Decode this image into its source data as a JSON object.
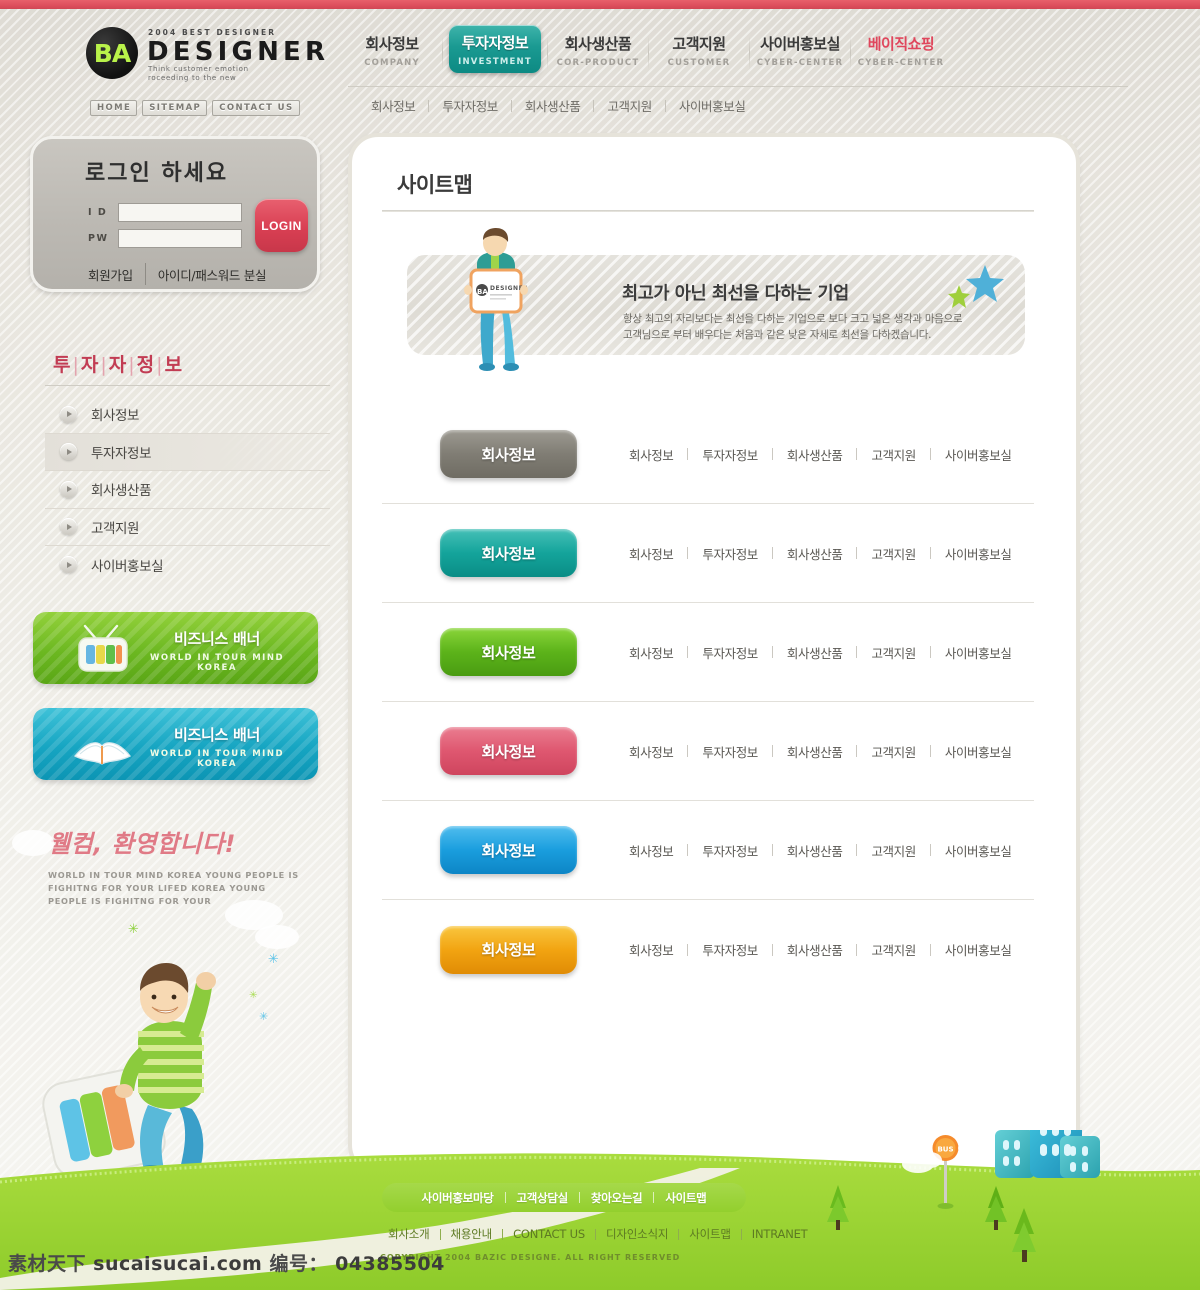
{
  "brand": {
    "badge": "BA",
    "sup": "2004 BEST DESIGNER",
    "name": "DESIGNER",
    "tagline_l1": "Think customer emotion",
    "tagline_l2": "roceeding to the new"
  },
  "mininav": [
    {
      "label": "HOME"
    },
    {
      "label": "SITEMAP"
    },
    {
      "label": "CONTACT US"
    }
  ],
  "mainnav": [
    {
      "kr": "회사정보",
      "en": "COMPANY",
      "active": false,
      "accent": false
    },
    {
      "kr": "투자자정보",
      "en": "INVESTMENT",
      "active": true,
      "accent": false
    },
    {
      "kr": "회사생산품",
      "en": "COR-PRODUCT",
      "active": false,
      "accent": false
    },
    {
      "kr": "고객지원",
      "en": "CUSTOMER",
      "active": false,
      "accent": false
    },
    {
      "kr": "사이버홍보실",
      "en": "CYBER-CENTER",
      "active": false,
      "accent": false
    },
    {
      "kr": "베이직쇼핑",
      "en": "CYBER-CENTER",
      "active": false,
      "accent": true
    }
  ],
  "subnav": [
    "회사정보",
    "투자자정보",
    "회사생산품",
    "고객지원",
    "사이버홍보실"
  ],
  "login": {
    "title": "로그인 하세요",
    "id_label": "I D",
    "pw_label": "PW",
    "id_value": "",
    "pw_value": "",
    "id_placeholder": "",
    "pw_placeholder": "",
    "button": "LOGIN",
    "join": "회원가입",
    "findpw": "아이디/패스워드 분실"
  },
  "sidebar": {
    "title": "투|자|자|정|보",
    "title_plain": "투자자정보",
    "items": [
      {
        "label": "회사정보",
        "selected": false
      },
      {
        "label": "투자자정보",
        "selected": true
      },
      {
        "label": "회사생산품",
        "selected": false
      },
      {
        "label": "고객지원",
        "selected": false
      },
      {
        "label": "사이버홍보실",
        "selected": false
      }
    ]
  },
  "banners": [
    {
      "kr": "비즈니스 배너",
      "en": "WORLD IN TOUR MIND KOREA",
      "icon": "tv-icon",
      "color": "#6cb821"
    },
    {
      "kr": "비즈니스 배너",
      "en": "WORLD IN TOUR MIND KOREA",
      "icon": "book-icon",
      "color": "#16a5c2"
    }
  ],
  "welcome": {
    "title": "웰컴, 환영합니다!",
    "body_l1": "WORLD IN TOUR MIND KOREA YOUNG PEOPLE IS",
    "body_l2": "FIGHITNG  FOR YOUR LIFED KOREA YOUNG",
    "body_l3": "PEOPLE IS  FIGHITNG FOR YOUR"
  },
  "main": {
    "page_title": "사이트맵",
    "hero": {
      "headline": "최고가 아닌 최선을 다하는 기업",
      "body_l1": "항상 최고의 자리보다는 최선을 다하는 기업으로 보다 크고 넓은 생각과 마음으로",
      "body_l2": "고객님으로 부터 배우다는 처음과 같은 낮은 자세로 최선을 다하겠습니다.",
      "placard": "DESIGNER"
    },
    "sitemap_links": [
      "회사정보",
      "투자자정보",
      "회사생산품",
      "고객지원",
      "사이버홍보실"
    ],
    "rows": [
      {
        "button": "회사정보",
        "color": "#807d74",
        "color_top": "#9d9a92",
        "color_bot": "#6f6c63"
      },
      {
        "button": "회사정보",
        "color": "#14a49b",
        "color_top": "#45c0b7",
        "color_bot": "#0a8d86"
      },
      {
        "button": "회사정보",
        "color": "#5cb31a",
        "color_top": "#8ad53a",
        "color_bot": "#4a9c12"
      },
      {
        "button": "회사정보",
        "color": "#df5770",
        "color_top": "#ea7d90",
        "color_bot": "#cf455e"
      },
      {
        "button": "회사정보",
        "color": "#1a9ede",
        "color_top": "#50bdee",
        "color_bot": "#0d85c6"
      },
      {
        "button": "회사정보",
        "color": "#f2a411",
        "color_top": "#f9c63f",
        "color_bot": "#e08c05"
      }
    ]
  },
  "footer": {
    "primary_links": [
      "사이버홍보마당",
      "고객상담실",
      "찾아오는길",
      "사이트맵"
    ],
    "secondary_links": [
      "회사소개",
      "채용안내",
      "CONTACT US",
      "디자인소식지",
      "사이트맵",
      "INTRANET"
    ],
    "copyright": "COPYRIGHT 2004 BAZIC DESIGNE. ALL RIGHT RESERVED",
    "bus_sign": "BUS"
  },
  "watermark": {
    "text_cn": "素材天下",
    "site": "sucaisucai.com",
    "label": "编号：",
    "number": "04385504"
  },
  "colors": {
    "top_strip": "#dd4f5d",
    "accent_red": "#e0465c",
    "nav_active": "#1a9a92",
    "grass": "#9ed63a",
    "sidebar_title": "#d9556a"
  }
}
